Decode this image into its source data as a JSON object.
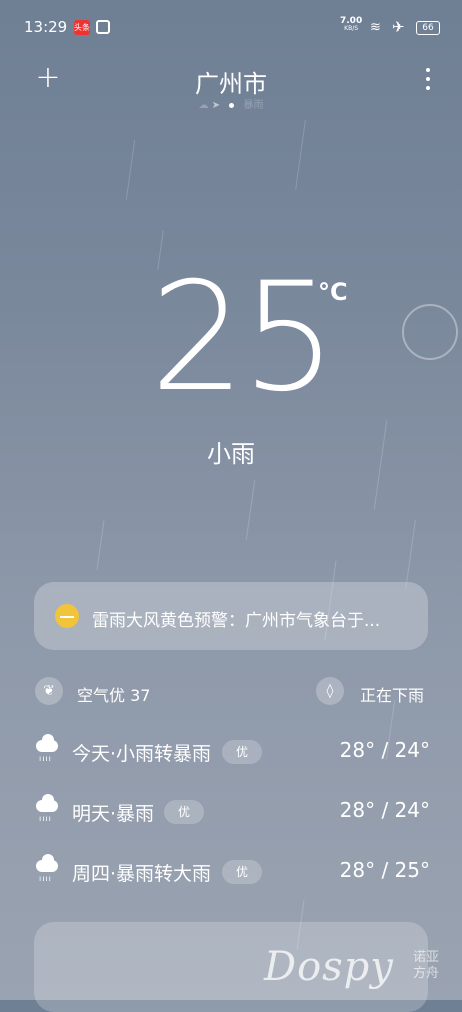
{
  "status_bar": {
    "time": "13:29",
    "app_badge": "头条",
    "net_speed_value": "7.00",
    "net_speed_unit": "KB/S",
    "battery": "66"
  },
  "header": {
    "city": "广州市",
    "pager_left": "☁",
    "pager_right": "暴雨"
  },
  "current": {
    "temperature": "25",
    "unit": "°C",
    "condition": "小雨"
  },
  "alert": {
    "text": "雷雨大风黄色预警：广州市气象台于..."
  },
  "summary": {
    "air_quality": "空气优 37",
    "precip_status": "正在下雨"
  },
  "forecast": [
    {
      "label": "今天·小雨转暴雨",
      "aqi": "优",
      "range": "28° / 24°"
    },
    {
      "label": "明天·暴雨",
      "aqi": "优",
      "range": "28° / 24°"
    },
    {
      "label": "周四·暴雨转大雨",
      "aqi": "优",
      "range": "28° / 25°"
    }
  ],
  "watermark": {
    "brand": "Dospy",
    "cn": "诺亚方舟"
  },
  "colors": {
    "sky_top": "#6f7f94",
    "sky_bottom": "#9aa3b1",
    "alert_icon": "#f2c43a"
  },
  "icons": [
    "plus-icon",
    "more-icon",
    "location-icon",
    "warning-sun-icon",
    "leaf-icon",
    "droplet-icon",
    "rain-cloud-icon"
  ]
}
